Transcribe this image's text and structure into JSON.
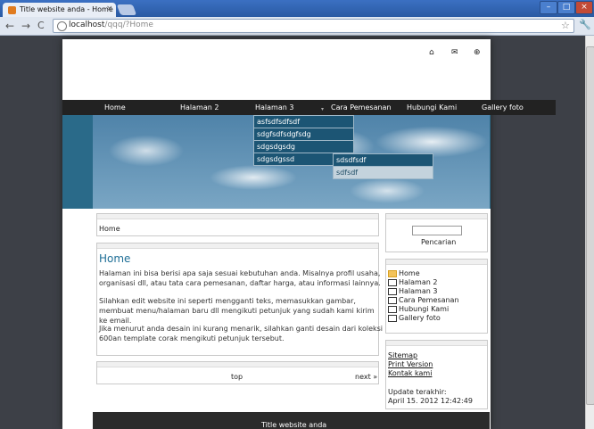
{
  "browser": {
    "tab_title": "Title website anda - Home",
    "tab_close": "×",
    "url_host": "localhost",
    "url_path": "/qqq/?Home",
    "back": "←",
    "forward": "→",
    "reload": "C",
    "star": "☆",
    "wrench": "🔧",
    "win_min": "–",
    "win_max": "□",
    "win_close": "×"
  },
  "top_icons": {
    "home": "⌂",
    "mail": "✉",
    "sitemap": "⊕"
  },
  "menu": {
    "items": [
      "Home",
      "Halaman 2",
      "Halaman 3",
      "Cara Pemesanan",
      "Hubungi Kami",
      "Gallery foto"
    ],
    "arrow": "▾",
    "submenu": [
      "asfsdfsdfsdf",
      "sdgfsdfsdgfsdg",
      "sdgsdgsdg",
      "sdgsdgssd"
    ],
    "subsubmenu": [
      "sdsdfsdf",
      "sdfsdf"
    ]
  },
  "breadcrumb": "Home",
  "content": {
    "title": "Home",
    "p1": "Halaman ini bisa berisi apa saja sesuai kebutuhan anda. Misalnya profil usaha, organisasi dll, atau tata cara pemesanan, daftar harga, atau informasi lainnya.",
    "p2": "Silahkan edit website ini seperti mengganti teks, memasukkan gambar, membuat menu/halaman baru dll mengikuti petunjuk yang sudah kami kirim ke email.",
    "p3": "Jika menurut anda desain ini kurang menarik, silahkan ganti desain dari koleksi 600an template corak mengikuti petunjuk tersebut."
  },
  "pager": {
    "top": "top",
    "next": "next »"
  },
  "sidebar": {
    "search_label": "Pencarian",
    "links": [
      "Home",
      "Halaman 2",
      "Halaman 3",
      "Cara Pemesanan",
      "Hubungi Kami",
      "Gallery foto"
    ],
    "extra_links": [
      "Sitemap",
      "Print Version",
      "Kontak kami"
    ],
    "update_label": "Update terakhir:",
    "update_date": "April 15. 2012 12:42:49"
  },
  "footer": "Title website anda",
  "colors": {
    "accent": "#1e6e96",
    "menubar": "#222222",
    "dropdown": "#1c5574"
  }
}
